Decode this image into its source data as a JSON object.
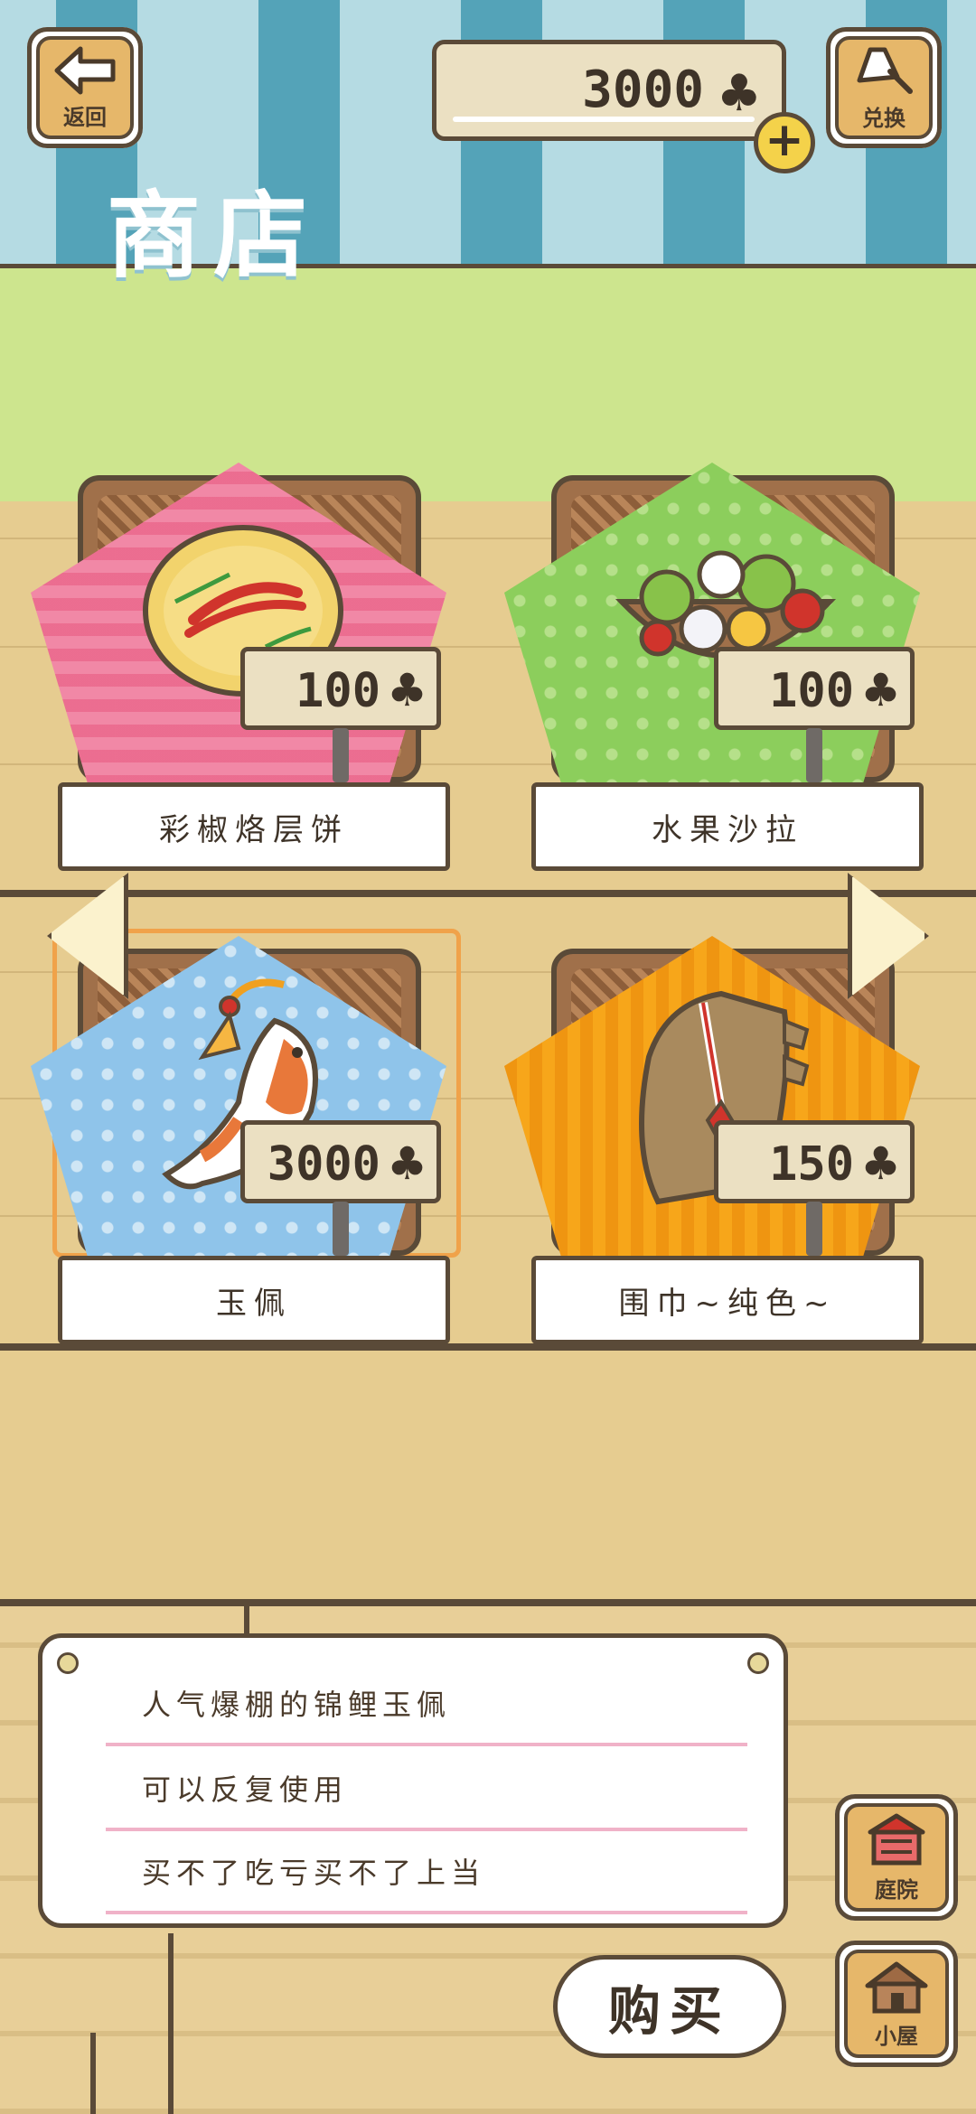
{
  "header": {
    "back_label": "返回",
    "coins": "3000",
    "coin_icon": "clover-icon",
    "plus_icon": "plus-icon",
    "exchange_label": "兑换",
    "exchange_icon": "bell-icon",
    "title": "商店"
  },
  "items": [
    {
      "name": "彩椒烙层饼",
      "price": "100"
    },
    {
      "name": "水果沙拉",
      "price": "100"
    },
    {
      "name": "玉佩",
      "price": "3000"
    },
    {
      "name": "围巾~纯色~",
      "price": "150"
    }
  ],
  "description": {
    "lines": [
      "人气爆棚的锦鲤玉佩",
      "可以反复使用",
      "买不了吃亏买不了上当"
    ]
  },
  "buy_label": "购买",
  "side_nav": {
    "yard_label": "庭院",
    "house_label": "小屋"
  },
  "colors": {
    "outline": "#5a4a38",
    "awning_dark": "#54a3b8",
    "awning_light": "#b5dbe3",
    "wall": "#cde58e",
    "floor": "#e6cc90",
    "wood_button": "#e6b76a",
    "selected": "#f0a24a"
  }
}
